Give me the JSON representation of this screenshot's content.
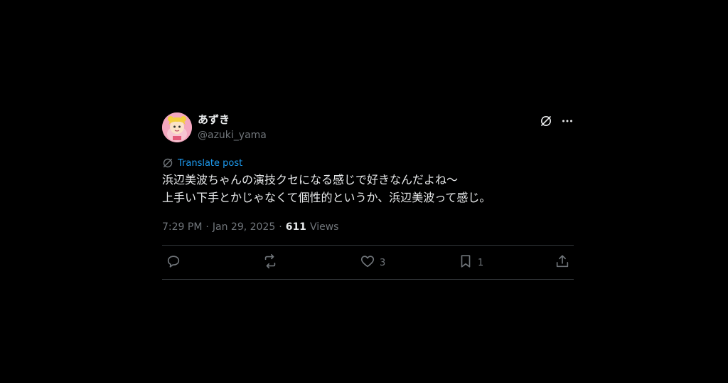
{
  "tweet": {
    "display_name": "あずき",
    "handle": "@azuki_yama",
    "translate_label": "Translate post",
    "text": "浜辺美波ちゃんの演技クセになる感じで好きなんだよね〜\n上手い下手とかじゃなくて個性的というか、浜辺美波って感じ。",
    "time": "7:29 PM",
    "date": "Jan 29, 2025",
    "separator": "·",
    "views_count": "611",
    "views_label": "Views",
    "likes_count": "3",
    "bookmarks_count": "1"
  },
  "icons": {
    "grok": "grok-icon",
    "more": "more-icon",
    "translate": "translate-icon",
    "reply": "reply-icon",
    "repost": "repost-icon",
    "like": "heart-icon",
    "bookmark": "bookmark-icon",
    "share": "share-icon"
  },
  "colors": {
    "background": "#000000",
    "text": "#e7e9ea",
    "secondary": "#71767b",
    "link": "#1d9bf0",
    "divider": "#2f3336",
    "avatar_bg": "#f2a0b8"
  }
}
